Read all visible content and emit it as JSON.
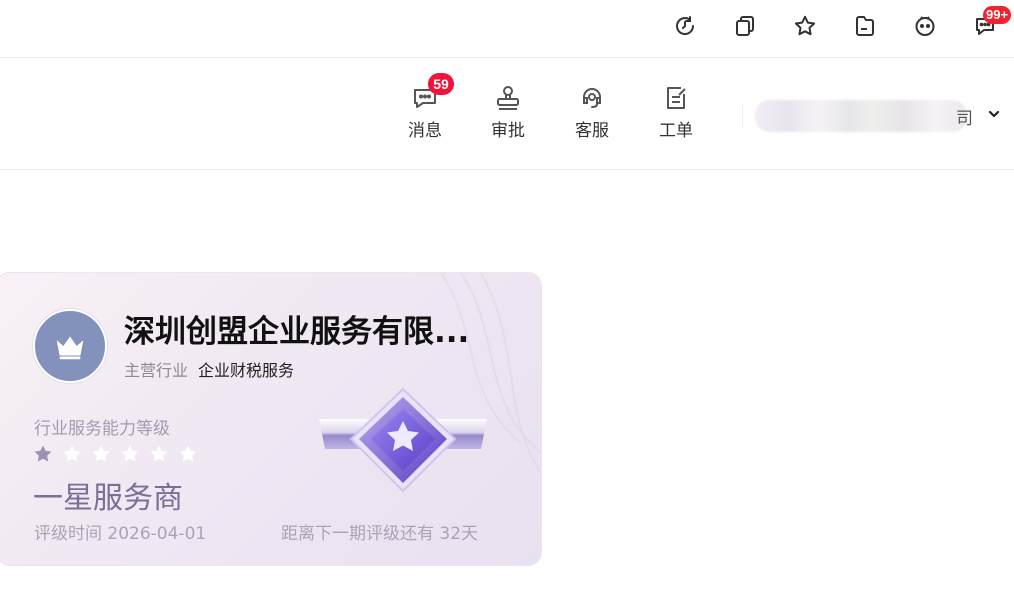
{
  "toolbar": {
    "icons": [
      "refresh-icon",
      "copy-icon",
      "star-icon",
      "folder-icon",
      "robot-face-icon",
      "chat-icon"
    ],
    "chat_badge": "99+"
  },
  "nav": {
    "items": [
      {
        "label": "消息",
        "icon": "message-icon",
        "badge": "59"
      },
      {
        "label": "审批",
        "icon": "stamp-icon"
      },
      {
        "label": "客服",
        "icon": "headset-icon"
      },
      {
        "label": "工单",
        "icon": "ticket-icon"
      }
    ],
    "company_tail": "司"
  },
  "card": {
    "company_name": "深圳创盟企业服务有限...",
    "industry_key": "主营行业",
    "industry_value": "企业财税服务",
    "level_label": "行业服务能力等级",
    "stars_total": 6,
    "stars_filled": 1,
    "level_name": "一星服务商",
    "rate_time": "评级时间 2026-04-01",
    "next_rate": "距离下一期评级还有 32天",
    "colors": {
      "star_filled": "#9b93b6",
      "star_empty": "#ffffff",
      "avatar_bg": "#8392bd",
      "medal": "#7d62d6"
    }
  }
}
